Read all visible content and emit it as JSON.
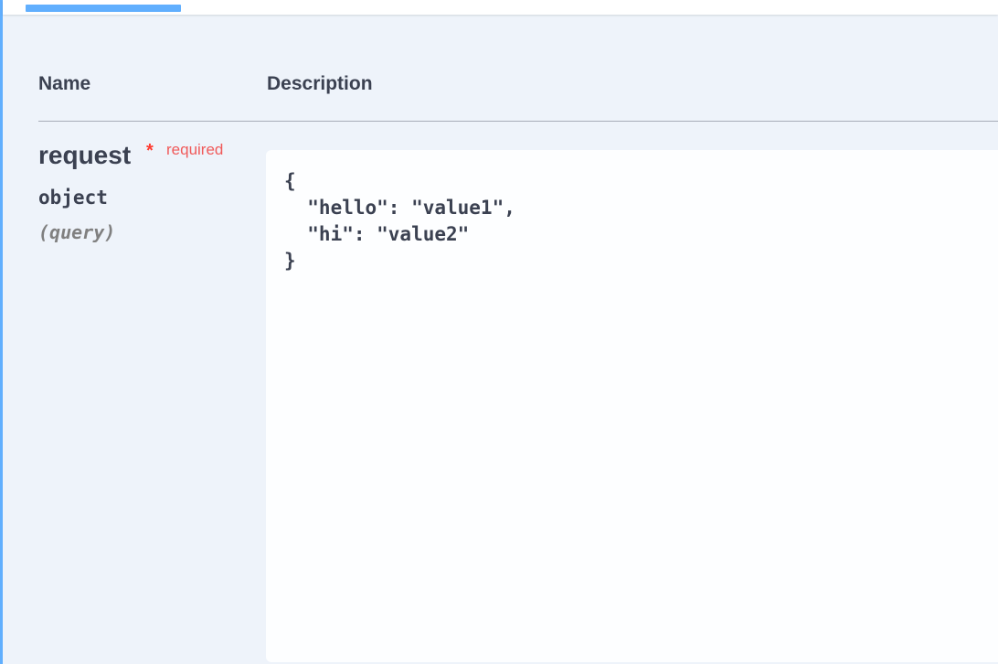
{
  "table": {
    "headers": {
      "name": "Name",
      "description": "Description"
    }
  },
  "parameter": {
    "name": "request",
    "required_star": "*",
    "required_label": "required",
    "type": "object",
    "in": "(query)",
    "value": "{\n  \"hello\": \"value1\",\n  \"hi\": \"value2\"\n}"
  },
  "colors": {
    "accent": "#61affe",
    "required": "#f05a5a",
    "text": "#3b4151",
    "background": "#eef3fa"
  }
}
